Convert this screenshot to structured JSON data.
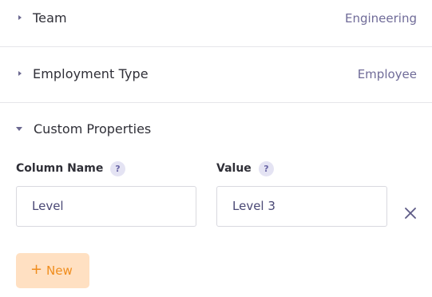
{
  "properties": [
    {
      "label": "Team",
      "value": "Engineering"
    },
    {
      "label": "Employment Type",
      "value": "Employee"
    }
  ],
  "custom_properties": {
    "title": "Custom Properties",
    "column_name_label": "Column Name",
    "value_label": "Value",
    "help_glyph": "?",
    "rows": [
      {
        "column_name": "Level",
        "value": "Level 3"
      }
    ],
    "new_button": {
      "plus": "+",
      "label": "New"
    }
  },
  "icons": {
    "collapsed": "caret-right-icon",
    "expanded": "caret-down-icon",
    "help": "help-icon",
    "remove": "close-icon"
  },
  "colors": {
    "label": "#2f2f37",
    "value": "#6f6b98",
    "accent_orange": "#f08d1d",
    "button_bg": "#ffe0c2"
  }
}
